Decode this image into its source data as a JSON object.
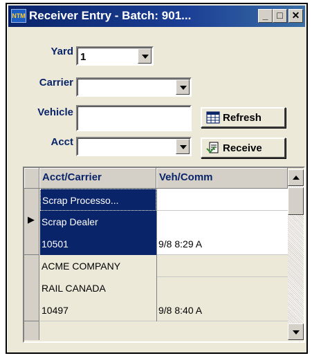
{
  "window": {
    "title": "Receiver Entry - Batch: 901...",
    "icon_text": "NTM",
    "minimize_glyph": "_",
    "maximize_glyph": "□",
    "close_glyph": "✕"
  },
  "form": {
    "yard": {
      "label": "Yard",
      "value": "1"
    },
    "carrier": {
      "label": "Carrier",
      "value": ""
    },
    "vehicle": {
      "label": "Vehicle",
      "value": ""
    },
    "acct": {
      "label": "Acct",
      "value": ""
    }
  },
  "buttons": {
    "refresh": {
      "label": "Refresh",
      "icon": "calendar-grid-icon"
    },
    "receive": {
      "label": "Receive",
      "icon": "receive-document-icon"
    }
  },
  "grid": {
    "columns": [
      "Acct/Carrier",
      "Veh/Comm"
    ],
    "row_indicator": "▶",
    "records": [
      {
        "selected": true,
        "acct_lines": [
          "Scrap Processo...",
          "Scrap Dealer",
          "10501"
        ],
        "veh_lines": [
          "",
          "",
          "9/8 8:29 A"
        ]
      },
      {
        "selected": false,
        "acct_lines": [
          "ACME COMPANY",
          "RAIL CANADA",
          "10497"
        ],
        "veh_lines": [
          "",
          "",
          "9/8 8:40 A"
        ]
      }
    ]
  },
  "colors": {
    "title_bar": "#0a246a",
    "label_text": "#0a246a",
    "selection": "#0a246a",
    "window_bg": "#ece9d8"
  }
}
